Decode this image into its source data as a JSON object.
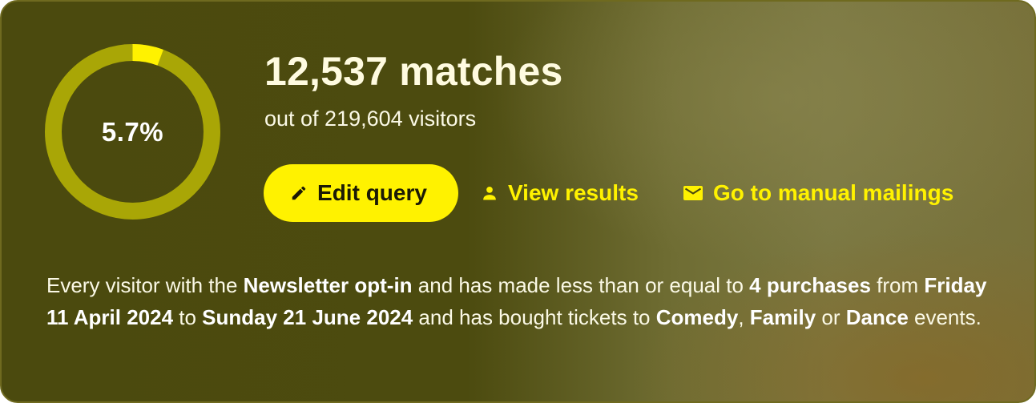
{
  "summary": {
    "percent_label": "5.7%",
    "percent_value": 5.7,
    "matches": "12,537 matches",
    "out_of": "out of 219,604 visitors"
  },
  "colors": {
    "accent": "#fff200",
    "ring_track": "#a9a606",
    "background_dark": "#4b4a0e",
    "text_light": "#fbf9e6"
  },
  "actions": {
    "edit_query": {
      "label": "Edit query",
      "icon": "pencil-icon"
    },
    "view_results": {
      "label": "View results",
      "icon": "person-icon"
    },
    "manual_mailings": {
      "label": "Go to manual mailings",
      "icon": "mail-icon"
    }
  },
  "description": {
    "t1": "Every visitor with the ",
    "b1": "Newsletter opt-in",
    "t2": " and has made less than or equal to ",
    "b2": "4 purchases",
    "t3": " from ",
    "b3": "Friday 11 April 2024",
    "t4": " to ",
    "b4": "Sunday 21 June 2024",
    "t5": " and has bought tickets to ",
    "b5": "Comedy",
    "t6": ", ",
    "b6": "Family",
    "t7": " or ",
    "b7": "Dance",
    "t8": " events."
  }
}
